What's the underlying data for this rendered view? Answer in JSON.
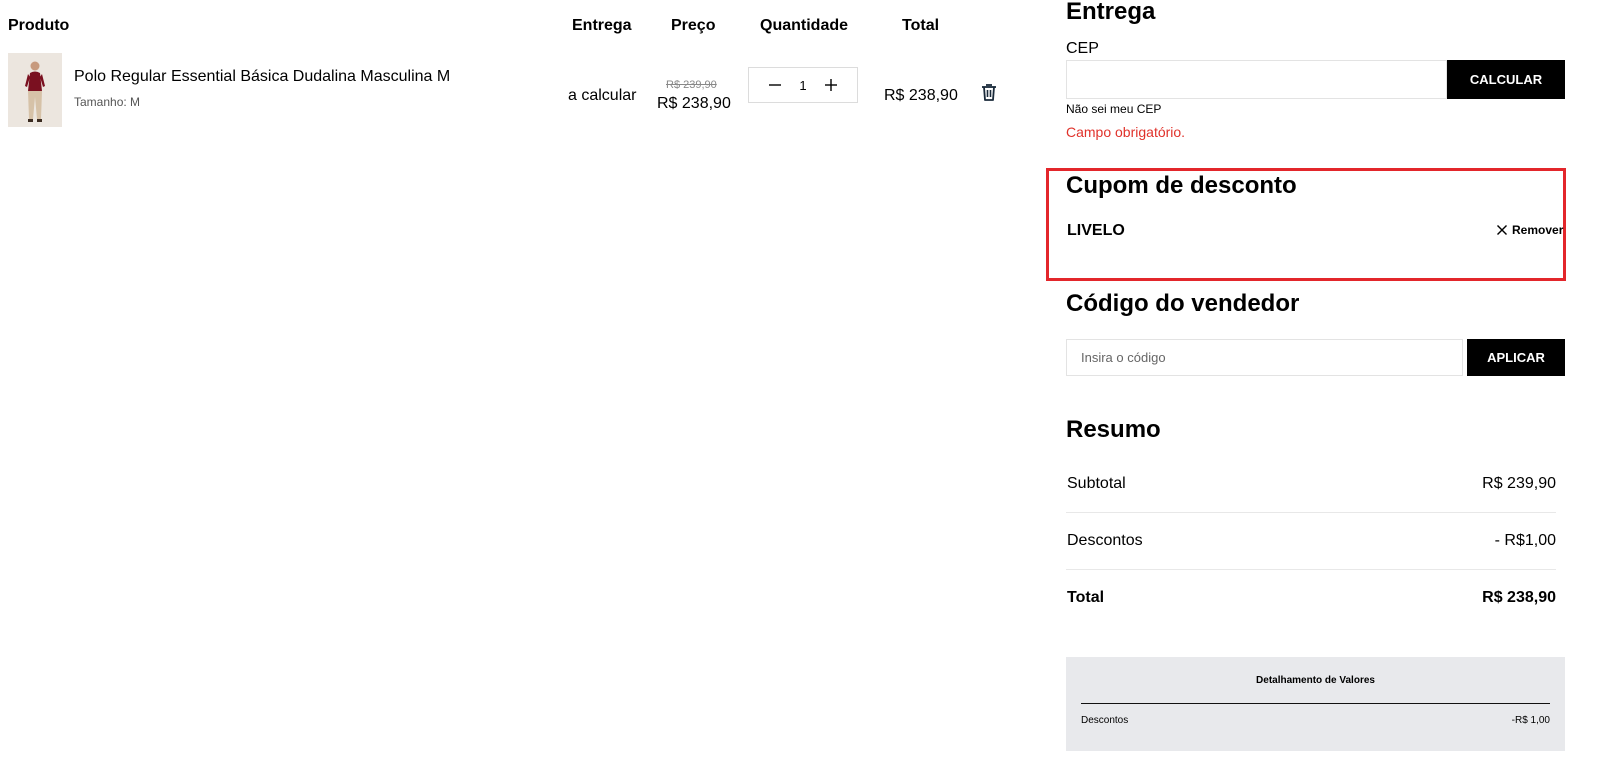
{
  "cart": {
    "headers": {
      "product": "Produto",
      "delivery": "Entrega",
      "price": "Preço",
      "quantity": "Quantidade",
      "total": "Total"
    },
    "item": {
      "name": "Polo Regular Essential Básica Dudalina Masculina M",
      "size": "Tamanho: M",
      "delivery": "a calcular",
      "price_old": "R$ 239,90",
      "price_new": "R$ 238,90",
      "quantity": "1",
      "total": "R$ 238,90",
      "thumbnail_icon": "product-photo-man-in-polo",
      "delete_icon": "trash-icon"
    }
  },
  "shipping": {
    "title": "Entrega",
    "cep_label": "CEP",
    "cep_value": "",
    "calc_button": "CALCULAR",
    "cep_help_link": "Não sei meu CEP",
    "error": "Campo obrigatório."
  },
  "coupon": {
    "title": "Cupom de desconto",
    "code": "LIVELO",
    "remove_label": "Remover",
    "remove_icon": "close-icon",
    "highlight_color": "#e3262b"
  },
  "seller": {
    "title": "Código do vendedor",
    "placeholder": "Insira o código",
    "apply_button": "APLICAR"
  },
  "summary": {
    "title": "Resumo",
    "subtotal_label": "Subtotal",
    "subtotal_value": "R$ 239,90",
    "discounts_label": "Descontos",
    "discounts_value": "- R$1,00",
    "total_label": "Total",
    "total_value": "R$ 238,90"
  },
  "details": {
    "title": "Detalhamento de Valores",
    "discounts_label": "Descontos",
    "discounts_value": "-R$ 1,00"
  },
  "colors": {
    "error_text": "#e0322b",
    "button_bg": "#000000",
    "details_bg": "#e8e9ec"
  }
}
